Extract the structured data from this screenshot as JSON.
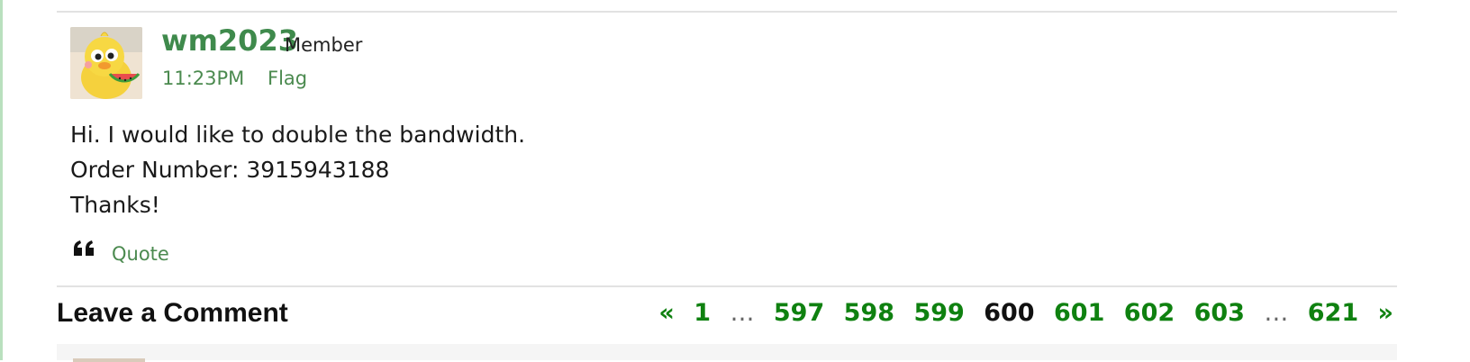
{
  "post": {
    "author": {
      "name": "wm2023",
      "role": "Member",
      "avatar_icon": "duckling-avatar-icon"
    },
    "time": "11:23PM",
    "flag_label": "Flag",
    "body": [
      "Hi. I would like to double the bandwidth.",
      "Order Number: 3915943188",
      "Thanks!"
    ],
    "quote_label": "Quote",
    "quote_icon": "quote-icon"
  },
  "comment": {
    "heading": "Leave a Comment"
  },
  "pagination": {
    "prev": "«",
    "first": "1",
    "ellipsis": "…",
    "pages": [
      "597",
      "598",
      "599",
      "600",
      "601",
      "602",
      "603"
    ],
    "current": "600",
    "last": "621",
    "next": "»"
  },
  "colors": {
    "link_green": "#0f8110",
    "author_green": "#3f8a4c",
    "accent_rule": "#b9e0be"
  }
}
